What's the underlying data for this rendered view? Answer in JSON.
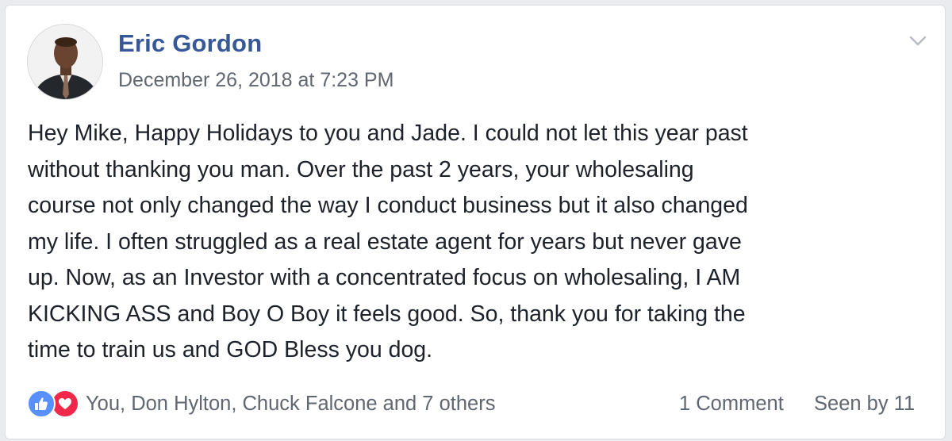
{
  "post": {
    "author": "Eric Gordon",
    "timestamp": "December 26, 2018 at 7:23 PM",
    "text_lines": [
      "Hey Mike, Happy Holidays to you and Jade. I could not let this year past",
      "without thanking you man. Over the past 2 years, your wholesaling",
      "course not only changed the way I conduct business but it also changed",
      "my life. I often struggled as a real estate agent for years but never gave",
      "up. Now, as an Investor with a concentrated focus on wholesaling, I AM",
      "KICKING ASS and Boy O Boy it feels good. So, thank you for taking the",
      "time to train us and GOD Bless you dog."
    ]
  },
  "footer": {
    "reactions_text": "You, Don Hylton, Chuck Falcone and 7 others",
    "comments": "1 Comment",
    "seen_by": "Seen by 11"
  },
  "icons": {
    "menu": "chevron-down-icon",
    "like": "like-icon",
    "love": "love-icon"
  },
  "colors": {
    "author_link": "#365899",
    "like": "#5890ff",
    "love": "#f0284a",
    "text": "#1d2129",
    "meta": "#616770"
  }
}
